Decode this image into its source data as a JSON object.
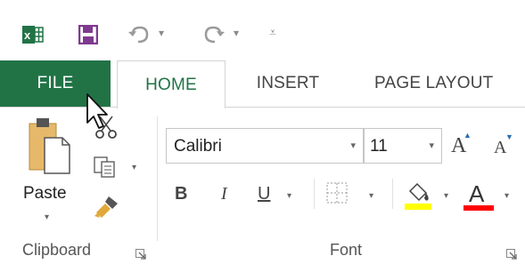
{
  "tabs": {
    "file": "FILE",
    "home": "HOME",
    "insert": "INSERT",
    "page_layout": "PAGE LAYOUT"
  },
  "clipboard": {
    "paste_label": "Paste",
    "group_label": "Clipboard"
  },
  "font": {
    "family_value": "Calibri",
    "size_value": "11",
    "bold": "B",
    "italic": "I",
    "underline": "U",
    "font_color_glyph": "A",
    "grow_glyph": "A",
    "shrink_glyph": "A",
    "group_label": "Font"
  },
  "colors": {
    "excel_green": "#217346",
    "highlight_yellow": "#ffff00",
    "font_red": "#ff0000",
    "save_purple": "#7f3a8f"
  }
}
